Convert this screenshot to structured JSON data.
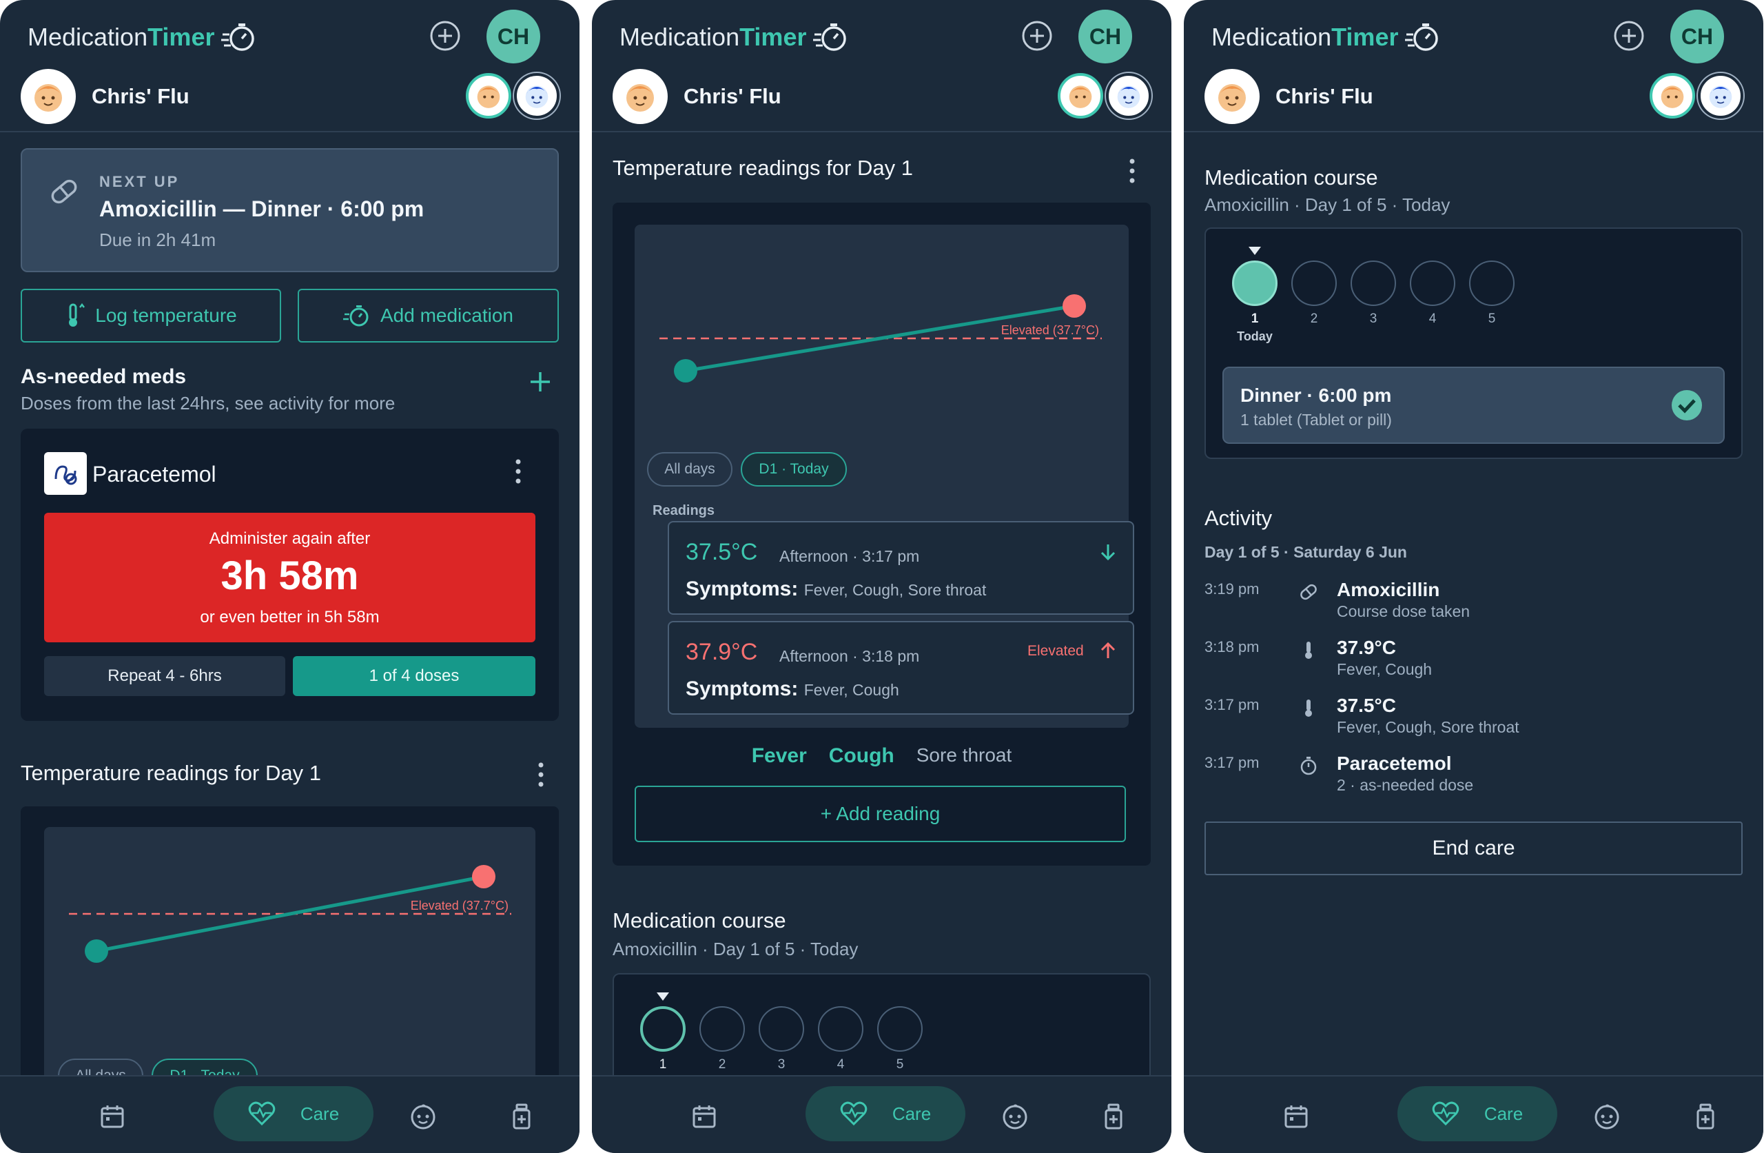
{
  "app": {
    "name_prefix": "Medication",
    "name_suffix": "Timer",
    "user_initials": "CH",
    "patient_name": "Chris' Flu"
  },
  "colors": {
    "background": "#1b2a3a",
    "card": "#101c2c",
    "accent": "#3ec7b0",
    "alert": "#dc2626",
    "elevated": "#f87171"
  },
  "screen1": {
    "next_up": {
      "label": "NEXT UP",
      "title": "Amoxicillin — Dinner · 6:00 pm",
      "due": "Due in 2h 41m"
    },
    "actions": {
      "log_temperature": "Log temperature",
      "add_medication": "Add medication"
    },
    "as_needed": {
      "title": "As-needed meds",
      "subtitle": "Doses from the last 24hrs, see activity for more"
    },
    "med_card": {
      "name": "Paracetemol",
      "administer_label": "Administer again after",
      "countdown": "3h 58m",
      "better_label": "or even better in 5h 58m",
      "repeat": "Repeat 4 - 6hrs",
      "doses": "1 of 4 doses"
    },
    "temp_section_title": "Temperature readings for Day 1",
    "chips": [
      "All days",
      "D1 · Today"
    ]
  },
  "screen2": {
    "temp_section_title": "Temperature readings for Day 1",
    "chips": [
      "All days",
      "D1 · Today"
    ],
    "readings_label": "Readings",
    "readings": [
      {
        "temp": "37.5°C",
        "when": "Afternoon · 3:17 pm",
        "symptoms_label": "Symptoms:",
        "symptoms": "Fever, Cough, Sore throat",
        "flag": ""
      },
      {
        "temp": "37.9°C",
        "when": "Afternoon · 3:18 pm",
        "symptoms_label": "Symptoms:",
        "symptoms": "Fever, Cough",
        "flag": "Elevated"
      }
    ],
    "legend": [
      "Fever",
      "Cough",
      "Sore throat"
    ],
    "add_reading": "+ Add reading",
    "course": {
      "title": "Medication course",
      "subtitle": "Amoxicillin · Day 1 of 5 · Today",
      "days": [
        "1",
        "2",
        "3",
        "4",
        "5"
      ]
    }
  },
  "screen3": {
    "course": {
      "title": "Medication course",
      "subtitle": "Amoxicillin · Day 1 of 5 · Today",
      "days": [
        "1",
        "2",
        "3",
        "4",
        "5"
      ],
      "today_label": "Today",
      "dose_title": "Dinner · 6:00 pm",
      "dose_detail": "1 tablet (Tablet or pill)"
    },
    "activity": {
      "title": "Activity",
      "day_label": "Day 1 of 5 · Saturday 6 Jun",
      "items": [
        {
          "time": "3:19 pm",
          "icon": "pill-icon",
          "title": "Amoxicillin",
          "detail": "Course dose taken"
        },
        {
          "time": "3:18 pm",
          "icon": "thermometer-icon",
          "title": "37.9°C",
          "detail": "Fever, Cough"
        },
        {
          "time": "3:17 pm",
          "icon": "thermometer-icon",
          "title": "37.5°C",
          "detail": "Fever, Cough, Sore throat"
        },
        {
          "time": "3:17 pm",
          "icon": "stopwatch-icon",
          "title": "Paracetemol",
          "detail": "2 · as-needed dose"
        }
      ]
    },
    "end_care": "End care"
  },
  "nav": {
    "care_label": "Care",
    "items": [
      "calendar-icon",
      "heart-icon",
      "baby-face-icon",
      "medicine-bottle-icon"
    ]
  },
  "chart_data": {
    "type": "line",
    "title": "Temperature readings for Day 1",
    "xlabel": "",
    "ylabel": "",
    "x": [
      "3:17 pm",
      "3:18 pm"
    ],
    "series": [
      {
        "values": [
          37.5,
          37.9
        ]
      }
    ],
    "threshold": {
      "label": "Elevated (37.7°C)",
      "value": 37.7
    },
    "ylim": [
      37.2,
      38.0
    ],
    "grid": false
  }
}
